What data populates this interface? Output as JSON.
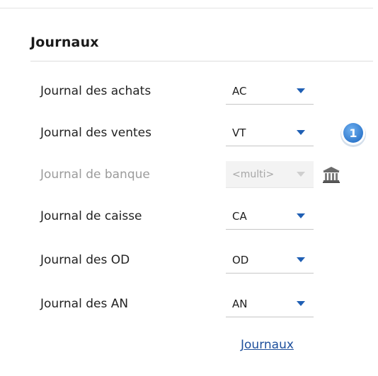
{
  "section": {
    "title": "Journaux"
  },
  "journals": [
    {
      "label": "Journal des achats",
      "value": "AC",
      "disabled": false
    },
    {
      "label": "Journal des ventes",
      "value": "VT",
      "disabled": false
    },
    {
      "label": "Journal de banque",
      "value": "<multi>",
      "disabled": true
    },
    {
      "label": "Journal de caisse",
      "value": "CA",
      "disabled": false
    },
    {
      "label": "Journal des OD",
      "value": "OD",
      "disabled": false
    },
    {
      "label": "Journal des AN",
      "value": "AN",
      "disabled": false
    }
  ],
  "badge": {
    "number": "1"
  },
  "footer": {
    "link_label": "Journaux"
  },
  "icons": {
    "dropdown": "chevron-down-icon",
    "bank": "bank-icon"
  },
  "colors": {
    "accent": "#1f5fb4",
    "link": "#1d4f9c",
    "badge": "#3c87d8",
    "disabled_text": "#9b9b9b"
  }
}
